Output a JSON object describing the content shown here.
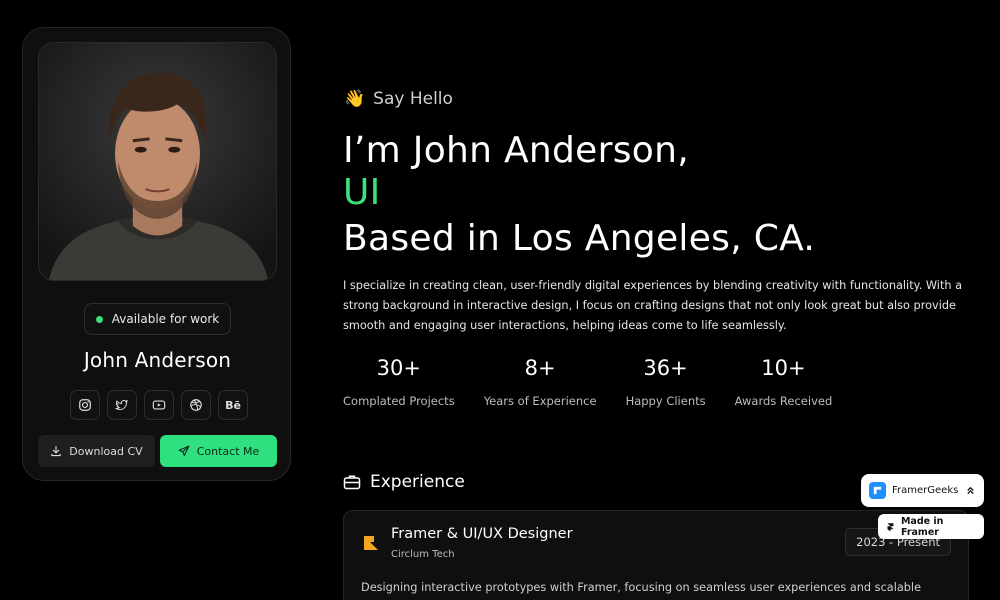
{
  "profile": {
    "availability": "Available for work",
    "name": "John Anderson",
    "socials": [
      {
        "icon": "instagram-icon"
      },
      {
        "icon": "twitter-icon"
      },
      {
        "icon": "youtube-icon"
      },
      {
        "icon": "dribbble-icon"
      },
      {
        "icon": "behance-icon",
        "label": "Bē"
      }
    ],
    "download_label": "Download CV",
    "contact_label": "Contact Me",
    "accent": "#2ee07f"
  },
  "hero": {
    "greeting_emoji": "👋",
    "greeting": "Say Hello",
    "line1": "I’m John Anderson,",
    "line2": "UI",
    "line3": "Based in Los Angeles, CA.",
    "bio": "I specialize in creating clean, user-friendly digital experiences by blending creativity with functionality. With a strong background in interactive design, I focus on crafting designs that not only look great but also provide smooth and engaging user interactions, helping ideas come to life seamlessly."
  },
  "stats": [
    {
      "value": "30+",
      "label": "Complated Projects"
    },
    {
      "value": "8+",
      "label": "Years of Experience"
    },
    {
      "value": "36+",
      "label": "Happy Clients"
    },
    {
      "value": "10+",
      "label": "Awards Received"
    }
  ],
  "experience": {
    "title": "Experience",
    "items": [
      {
        "role": "Framer & UI/UX Designer",
        "company": "Circlum Tech",
        "date": "2023 - Present",
        "description": "Designing interactive prototypes with Framer, focusing on seamless user experiences and scalable"
      }
    ]
  },
  "floating": {
    "framergeeks_label": "FramerGeeks",
    "made_in_framer_label": "Made in Framer"
  }
}
